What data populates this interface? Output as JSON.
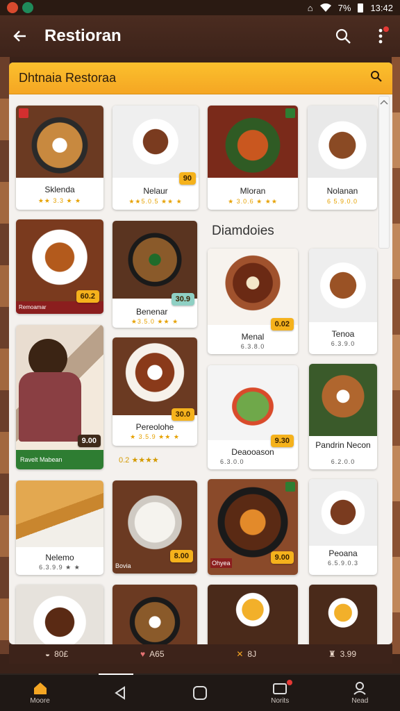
{
  "status": {
    "app_icons": [
      "app-icon",
      "chat-icon"
    ],
    "battery_text": "13:42",
    "sound_icon": "vibrate-icon",
    "signal_text": "7%"
  },
  "appbar": {
    "title": "Restioran",
    "back_icon": "arrow-back-icon",
    "search_icon": "search-icon",
    "menu_icon": "more-vert-icon"
  },
  "panel": {
    "title": "Dhtnaia  Restoraa",
    "search_icon": "search-icon"
  },
  "section_title": "Diamdoies",
  "cards": [
    {
      "id": "c1",
      "caption": "Sklenda",
      "stars": "★★ 3.3 ★ ★",
      "price": ""
    },
    {
      "id": "c2",
      "caption": "Nelaur",
      "stars": "★★5.0.5 ★★ ★",
      "price": "90"
    },
    {
      "id": "c3",
      "caption": "Mloran",
      "stars": "★ 3.0.6 ★ ★★",
      "price": ""
    },
    {
      "id": "c4",
      "caption": "Nolanan",
      "stars": "6 5.9.0.0",
      "price": ""
    },
    {
      "id": "c5",
      "caption": "Remoamar",
      "stars": "",
      "price": "60.2"
    },
    {
      "id": "c6",
      "caption": "Benenar",
      "stars": "★3.5.0 ★★ ★",
      "price": "30.9"
    },
    {
      "id": "c7",
      "caption": "Menal",
      "stars": "6.3.8.0",
      "price": "0.02"
    },
    {
      "id": "c8",
      "caption": "Tenoa",
      "stars": "6.3.9.0",
      "price": ""
    },
    {
      "id": "c9",
      "caption": "Ravelt Mabean",
      "stars": "",
      "price": "9.00"
    },
    {
      "id": "c10",
      "caption": "Pereolohe",
      "stars": "★ 3.5.9 ★★ ★",
      "price": "30.0"
    },
    {
      "id": "c11",
      "caption": "Deaooason",
      "stars": "6.3.0.0",
      "price": "9.30"
    },
    {
      "id": "c12",
      "caption": "Pandrin Necon",
      "stars": "6.2.0.0",
      "price": ""
    },
    {
      "id": "c13",
      "caption": "Nelemo",
      "stars": "6.3.9.9 ★ ★",
      "price": ""
    },
    {
      "id": "c14",
      "caption": "Bovia",
      "stars": "",
      "price": "8.00"
    },
    {
      "id": "c15",
      "caption": "Ohyea",
      "stars": "",
      "price": "9.00"
    },
    {
      "id": "c16",
      "caption": "Peoana",
      "stars": "6.5.9.0.3",
      "price": ""
    }
  ],
  "loose_rating": "0.2 ★★★★",
  "bottom_strip": [
    {
      "icon": "bowl-icon",
      "label": "80£"
    },
    {
      "icon": "heart-icon",
      "label": "A65"
    },
    {
      "icon": "tag-icon",
      "label": "8J"
    },
    {
      "icon": "bag-icon",
      "label": "3.99"
    }
  ],
  "nav": [
    {
      "icon": "home-icon",
      "label": "Moore"
    },
    {
      "icon": "back-triangle-icon",
      "label": ""
    },
    {
      "icon": "home-square-icon",
      "label": ""
    },
    {
      "icon": "cart-icon",
      "label": "Norits"
    },
    {
      "icon": "profile-icon",
      "label": "Nead"
    }
  ],
  "colors": {
    "accent": "#f5a623",
    "appbar": "#4b2c20",
    "price": "#f5b21c"
  }
}
